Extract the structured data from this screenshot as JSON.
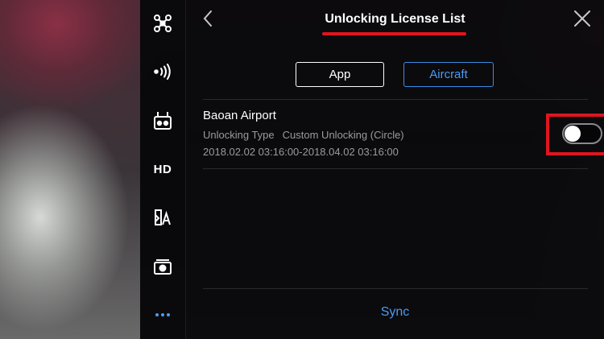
{
  "header": {
    "title": "Unlocking License List",
    "back_icon": "chevron-left-icon",
    "close_icon": "close-icon"
  },
  "sidebar": {
    "items": [
      {
        "icon": "aircraft-icon"
      },
      {
        "icon": "signal-icon"
      },
      {
        "icon": "remote-controller-icon"
      },
      {
        "label": "HD"
      },
      {
        "icon": "map-unlock-icon"
      },
      {
        "icon": "camera-icon"
      },
      {
        "icon": "more-icon"
      }
    ]
  },
  "tabs": {
    "app": "App",
    "aircraft": "Aircraft",
    "selected": "Aircraft"
  },
  "licenses": [
    {
      "name": "Baoan Airport",
      "type_label": "Unlocking Type",
      "type_value": "Custom Unlocking (Circle)",
      "date_range": "2018.02.02 03:16:00-2018.04.02 03:16:00",
      "enabled": false
    }
  ],
  "footer": {
    "sync_label": "Sync"
  },
  "colors": {
    "accent": "#4a9cf2",
    "highlight": "#e0141e",
    "text_primary": "#ffffff",
    "text_secondary": "#9a9a9e"
  }
}
